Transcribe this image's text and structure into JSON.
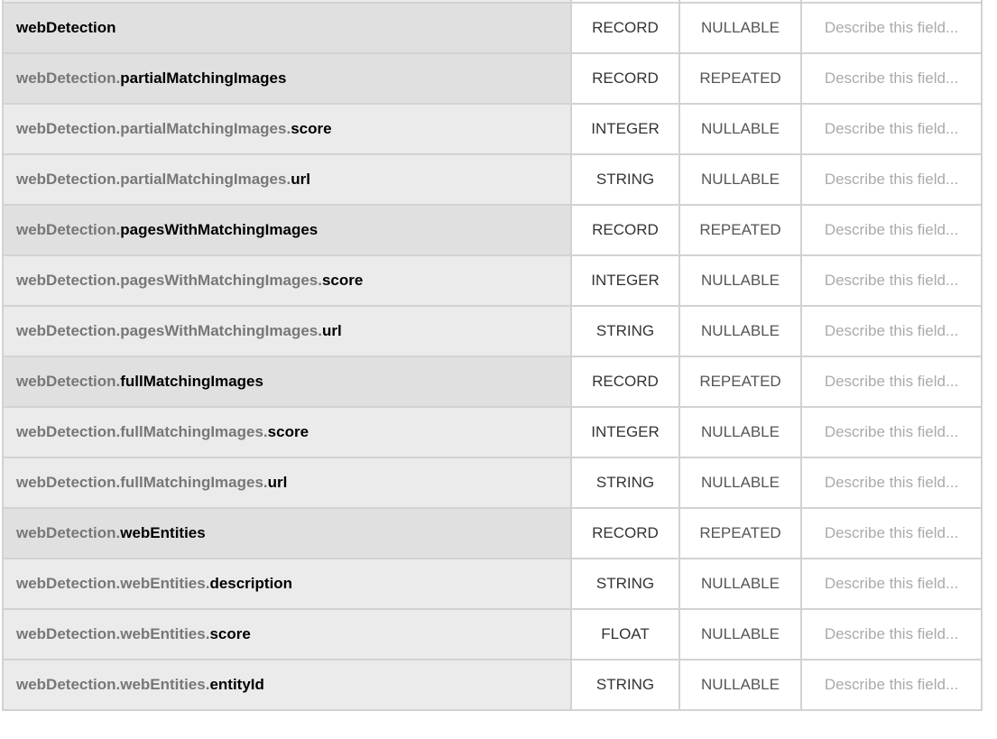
{
  "description_placeholder": "Describe this field...",
  "rows": [
    {
      "prefix": "",
      "leaf": "webDetection",
      "type": "RECORD",
      "mode": "NULLABLE"
    },
    {
      "prefix": "webDetection.",
      "leaf": "partialMatchingImages",
      "type": "RECORD",
      "mode": "REPEATED"
    },
    {
      "prefix": "webDetection.partialMatchingImages.",
      "leaf": "score",
      "type": "INTEGER",
      "mode": "NULLABLE"
    },
    {
      "prefix": "webDetection.partialMatchingImages.",
      "leaf": "url",
      "type": "STRING",
      "mode": "NULLABLE"
    },
    {
      "prefix": "webDetection.",
      "leaf": "pagesWithMatchingImages",
      "type": "RECORD",
      "mode": "REPEATED"
    },
    {
      "prefix": "webDetection.pagesWithMatchingImages.",
      "leaf": "score",
      "type": "INTEGER",
      "mode": "NULLABLE"
    },
    {
      "prefix": "webDetection.pagesWithMatchingImages.",
      "leaf": "url",
      "type": "STRING",
      "mode": "NULLABLE"
    },
    {
      "prefix": "webDetection.",
      "leaf": "fullMatchingImages",
      "type": "RECORD",
      "mode": "REPEATED"
    },
    {
      "prefix": "webDetection.fullMatchingImages.",
      "leaf": "score",
      "type": "INTEGER",
      "mode": "NULLABLE"
    },
    {
      "prefix": "webDetection.fullMatchingImages.",
      "leaf": "url",
      "type": "STRING",
      "mode": "NULLABLE"
    },
    {
      "prefix": "webDetection.",
      "leaf": "webEntities",
      "type": "RECORD",
      "mode": "REPEATED"
    },
    {
      "prefix": "webDetection.webEntities.",
      "leaf": "description",
      "type": "STRING",
      "mode": "NULLABLE"
    },
    {
      "prefix": "webDetection.webEntities.",
      "leaf": "score",
      "type": "FLOAT",
      "mode": "NULLABLE"
    },
    {
      "prefix": "webDetection.webEntities.",
      "leaf": "entityId",
      "type": "STRING",
      "mode": "NULLABLE"
    }
  ]
}
